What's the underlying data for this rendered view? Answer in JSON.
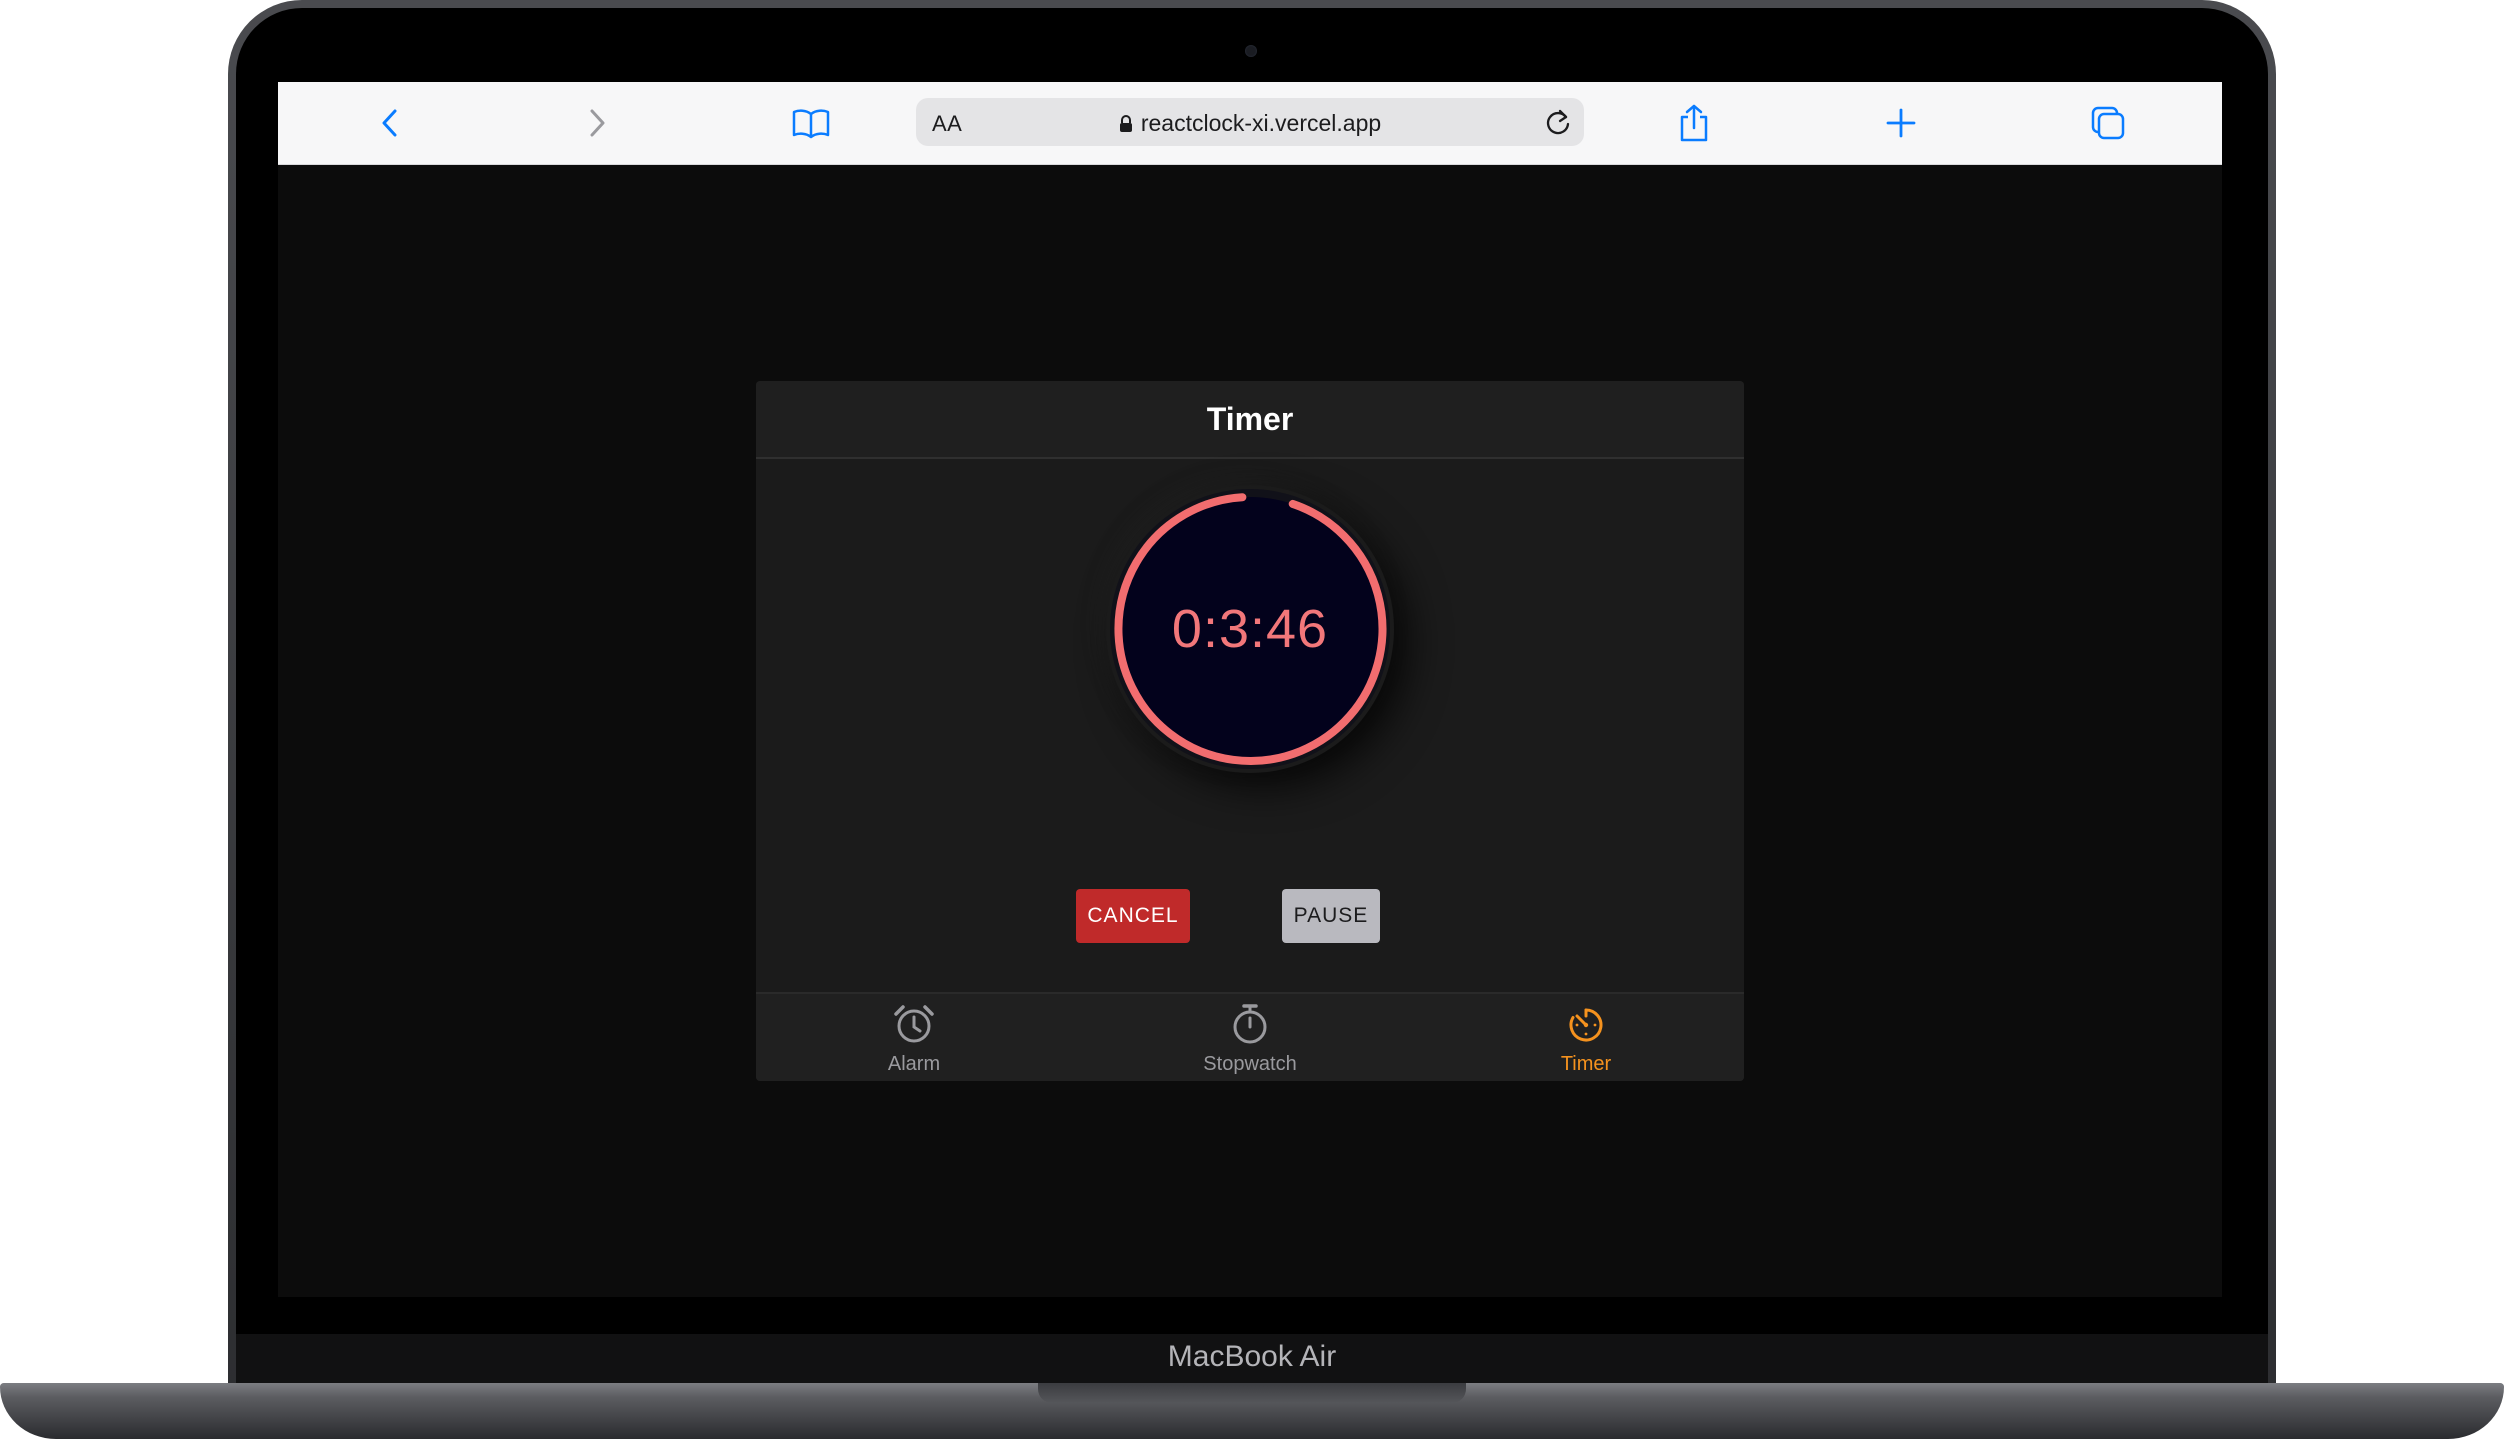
{
  "device": {
    "brand_label": "MacBook Air"
  },
  "browser": {
    "text_size_label": "AA",
    "url": "reactclock-xi.vercel.app",
    "accent_color": "#0a7cff"
  },
  "app": {
    "title": "Timer",
    "timer": {
      "display": "0:3:46",
      "ring_color": "#f26d6f",
      "face_color": "#03021c"
    },
    "buttons": {
      "cancel_label": "CANCEL",
      "pause_label": "PAUSE"
    },
    "tabs": [
      {
        "label": "Alarm",
        "icon": "alarm-clock-icon",
        "active": false
      },
      {
        "label": "Stopwatch",
        "icon": "stopwatch-icon",
        "active": false
      },
      {
        "label": "Timer",
        "icon": "timer-icon",
        "active": true
      }
    ],
    "active_color": "#f5921e"
  }
}
